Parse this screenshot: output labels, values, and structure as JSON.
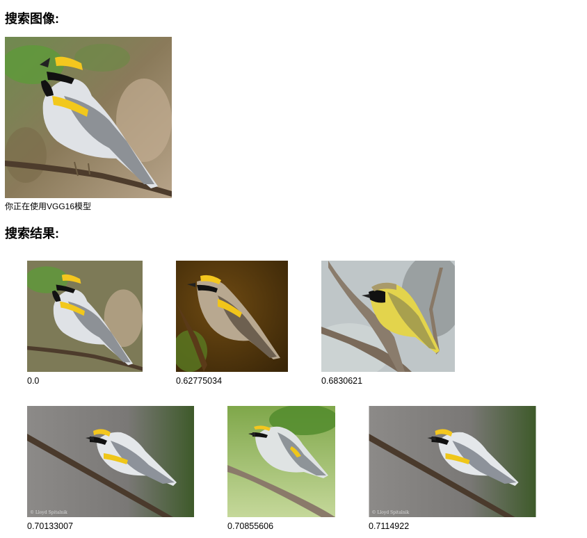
{
  "query_section": {
    "heading": "搜索图像:",
    "image_alt": "golden-winged warbler singing on branch",
    "model_note": "你正在使用VGG16模型"
  },
  "results_section": {
    "heading": "搜索结果:",
    "results": [
      {
        "distance": "0.0",
        "image_alt": "golden-winged warbler singing on branch"
      },
      {
        "distance": "0.62775034",
        "image_alt": "golden-winged warbler on twig, dark background"
      },
      {
        "distance": "0.6830621",
        "image_alt": "common yellowthroat on branch"
      },
      {
        "distance": "0.70133007",
        "image_alt": "golden-winged warbler on diagonal branch"
      },
      {
        "distance": "0.70855606",
        "image_alt": "golden-winged warbler on branch, green background"
      },
      {
        "distance": "0.7114922",
        "image_alt": "golden-winged warbler on diagonal branch"
      }
    ]
  }
}
